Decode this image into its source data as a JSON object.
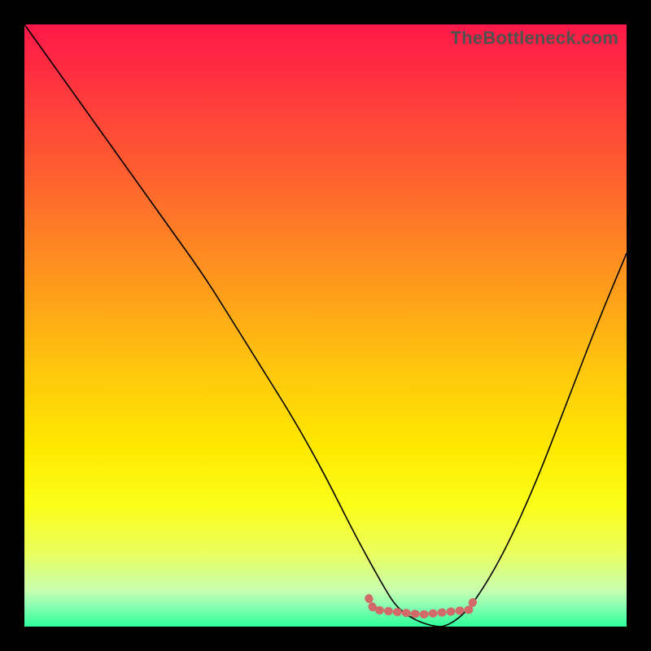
{
  "watermark": "TheBottleneck.com",
  "colors": {
    "gradient_top": "#ff1848",
    "gradient_bottom": "#2fff9a",
    "curve": "#000000",
    "flat_marker": "#d26a6a",
    "frame": "#000000"
  },
  "chart_data": {
    "type": "line",
    "title": "",
    "xlabel": "",
    "ylabel": "",
    "xlim": [
      0,
      100
    ],
    "ylim": [
      0,
      100
    ],
    "series": [
      {
        "name": "bottleneck-curve",
        "x": [
          0,
          5,
          10,
          15,
          20,
          25,
          30,
          35,
          40,
          45,
          50,
          55,
          60,
          62,
          65,
          68,
          70,
          73,
          76,
          80,
          85,
          90,
          95,
          100
        ],
        "values": [
          100,
          93,
          86,
          79,
          72,
          65,
          58,
          50,
          42,
          34,
          25,
          15,
          6,
          3,
          1,
          0,
          0,
          2,
          6,
          13,
          24,
          37,
          50,
          62
        ]
      }
    ],
    "flat_region": {
      "x_start": 58,
      "x_end": 74,
      "y": 2
    },
    "annotations": []
  }
}
